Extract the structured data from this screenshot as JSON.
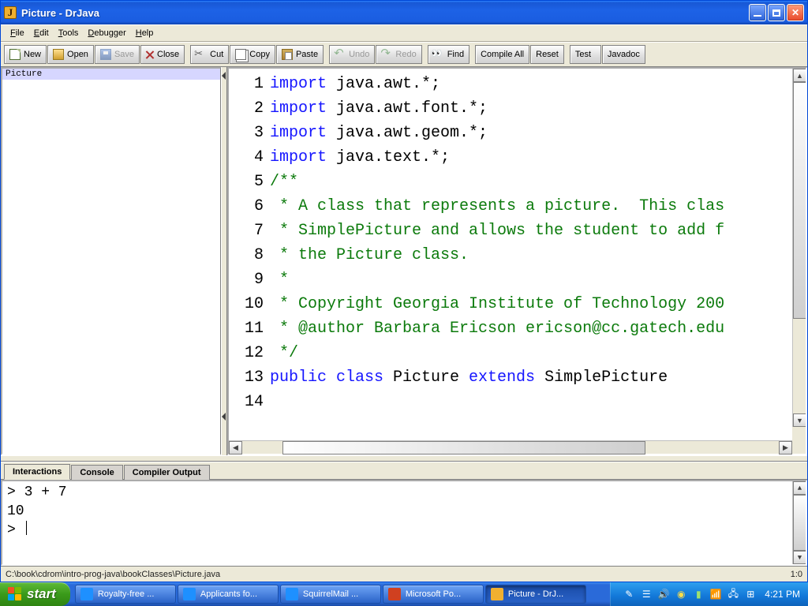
{
  "window": {
    "title": "Picture - DrJava"
  },
  "menu": {
    "file": {
      "u": "F",
      "rest": "ile"
    },
    "edit": {
      "u": "E",
      "rest": "dit"
    },
    "tools": {
      "u": "T",
      "rest": "ools"
    },
    "debugger": {
      "u": "D",
      "rest": "ebugger"
    },
    "help": {
      "u": "H",
      "rest": "elp"
    }
  },
  "toolbar": {
    "new": "New",
    "open": "Open",
    "save": "Save",
    "close": "Close",
    "cut": "Cut",
    "copy": "Copy",
    "paste": "Paste",
    "undo": "Undo",
    "redo": "Redo",
    "find": "Find",
    "compile": "Compile All",
    "reset": "Reset",
    "test": "Test",
    "javadoc": "Javadoc"
  },
  "files": {
    "items": [
      "Picture"
    ]
  },
  "code": {
    "lines": [
      {
        "n": "1",
        "seg": [
          {
            "c": "kw",
            "t": "import"
          },
          {
            "c": "",
            "t": " java.awt.*;"
          }
        ]
      },
      {
        "n": "2",
        "seg": [
          {
            "c": "kw",
            "t": "import"
          },
          {
            "c": "",
            "t": " java.awt.font.*;"
          }
        ]
      },
      {
        "n": "3",
        "seg": [
          {
            "c": "kw",
            "t": "import"
          },
          {
            "c": "",
            "t": " java.awt.geom.*;"
          }
        ]
      },
      {
        "n": "4",
        "seg": [
          {
            "c": "kw",
            "t": "import"
          },
          {
            "c": "",
            "t": " java.text.*;"
          }
        ]
      },
      {
        "n": "5",
        "seg": [
          {
            "c": "",
            "t": ""
          }
        ]
      },
      {
        "n": "6",
        "seg": [
          {
            "c": "cm",
            "t": "/**"
          }
        ]
      },
      {
        "n": "7",
        "seg": [
          {
            "c": "cm",
            "t": " * A class that represents a picture.  This clas"
          }
        ]
      },
      {
        "n": "8",
        "seg": [
          {
            "c": "cm",
            "t": " * SimplePicture and allows the student to add f"
          }
        ]
      },
      {
        "n": "9",
        "seg": [
          {
            "c": "cm",
            "t": " * the Picture class."
          }
        ]
      },
      {
        "n": "10",
        "seg": [
          {
            "c": "cm",
            "t": " *"
          }
        ]
      },
      {
        "n": "11",
        "seg": [
          {
            "c": "cm",
            "t": " * Copyright Georgia Institute of Technology 200"
          }
        ]
      },
      {
        "n": "12",
        "seg": [
          {
            "c": "cm",
            "t": " * @author Barbara Ericson ericson@cc.gatech.edu"
          }
        ]
      },
      {
        "n": "13",
        "seg": [
          {
            "c": "cm",
            "t": " */"
          }
        ]
      },
      {
        "n": "14",
        "seg": [
          {
            "c": "kw",
            "t": "public class "
          },
          {
            "c": "",
            "t": "Picture "
          },
          {
            "c": "kw",
            "t": "extends"
          },
          {
            "c": "",
            "t": " SimplePicture"
          }
        ]
      }
    ]
  },
  "bottom_tabs": {
    "interactions": "Interactions",
    "console": "Console",
    "compiler": "Compiler Output"
  },
  "interactions": {
    "line1": "> 3 + 7",
    "line2": "10",
    "prompt": "> "
  },
  "status": {
    "path": "C:\\book\\cdrom\\intro-prog-java\\bookClasses\\Picture.java",
    "pos": "1:0"
  },
  "taskbar": {
    "start": "start",
    "items": [
      {
        "label": "Royalty-free ...",
        "color": "#1e90ff"
      },
      {
        "label": "Applicants fo...",
        "color": "#1e90ff"
      },
      {
        "label": "SquirrelMail ...",
        "color": "#1e90ff"
      },
      {
        "label": "Microsoft Po...",
        "color": "#d04020"
      },
      {
        "label": "Picture - DrJ...",
        "color": "#f0b030",
        "active": true
      }
    ],
    "clock": "4:21 PM"
  }
}
